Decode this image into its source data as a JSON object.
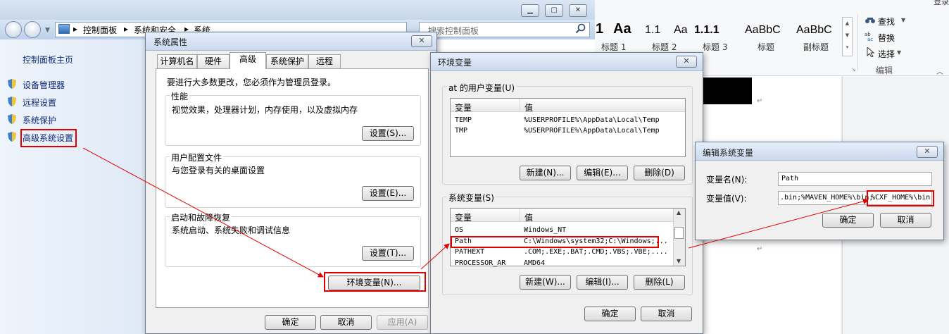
{
  "control_panel": {
    "breadcrumb": [
      "控制面板",
      "系统和安全",
      "系统"
    ],
    "search_placeholder": "搜索控制面板",
    "home": "控制面板主页",
    "links": [
      "设备管理器",
      "远程设置",
      "系统保护",
      "高级系统设置"
    ]
  },
  "word": {
    "styles": [
      {
        "preview": "1",
        "name": ""
      },
      {
        "preview": "Aa",
        "name": ""
      },
      {
        "preview": "1.1",
        "name": "标题 1"
      },
      {
        "preview": "Aa",
        "name": "标题 2"
      },
      {
        "preview": "1.1.1",
        "name": "标题 3"
      },
      {
        "preview": "AaBbC",
        "name": "标题"
      },
      {
        "preview": "AaBbC",
        "name": "副标题"
      }
    ],
    "edit_items": [
      "查找",
      "替换",
      "选择"
    ],
    "group_label": "编辑",
    "corner_text": "登录"
  },
  "system_properties": {
    "title": "系统属性",
    "tabs": [
      "计算机名",
      "硬件",
      "高级",
      "系统保护",
      "远程"
    ],
    "admin_note": "要进行大多数更改，您必须作为管理员登录。",
    "performance": {
      "label": "性能",
      "desc": "视觉效果，处理器计划，内存使用，以及虚拟内存",
      "button": "设置(S)..."
    },
    "user_profiles": {
      "label": "用户配置文件",
      "desc": "与您登录有关的桌面设置",
      "button": "设置(E)..."
    },
    "startup_recovery": {
      "label": "启动和故障恢复",
      "desc": "系统启动、系统失败和调试信息",
      "button": "设置(T)..."
    },
    "env_button": "环境变量(N)...",
    "ok": "确定",
    "cancel": "取消",
    "apply": "应用(A)"
  },
  "env_vars": {
    "title": "环境变量",
    "user_group": "at 的用户变量(U)",
    "col_var": "变量",
    "col_val": "值",
    "user_rows": [
      {
        "name": "TEMP",
        "value": "%USERPROFILE%\\AppData\\Local\\Temp"
      },
      {
        "name": "TMP",
        "value": "%USERPROFILE%\\AppData\\Local\\Temp"
      }
    ],
    "user_buttons": [
      "新建(N)...",
      "编辑(E)...",
      "删除(D)"
    ],
    "system_group": "系统变量(S)",
    "system_rows": [
      {
        "name": "OS",
        "value": "Windows_NT"
      },
      {
        "name": "Path",
        "value": "C:\\Windows\\system32;C:\\Windows;..."
      },
      {
        "name": "PATHEXT",
        "value": ".COM;.EXE;.BAT;.CMD;.VBS;.VBE;...."
      },
      {
        "name": "PROCESSOR_AR",
        "value": "AMD64"
      }
    ],
    "system_buttons": [
      "新建(W)...",
      "编辑(I)...",
      "删除(L)"
    ],
    "ok": "确定",
    "cancel": "取消"
  },
  "edit_var": {
    "title": "编辑系统变量",
    "name_label": "变量名(N):",
    "name_value": "Path",
    "value_label": "变量值(V):",
    "value_text": ".bin;%MAVEN_HOME%\\bin;",
    "value_highlight": "%CXF_HOME%\\bin",
    "ok": "确定",
    "cancel": "取消"
  },
  "colors": {
    "annotation_red": "#e00000",
    "link_blue": "#10287a"
  }
}
